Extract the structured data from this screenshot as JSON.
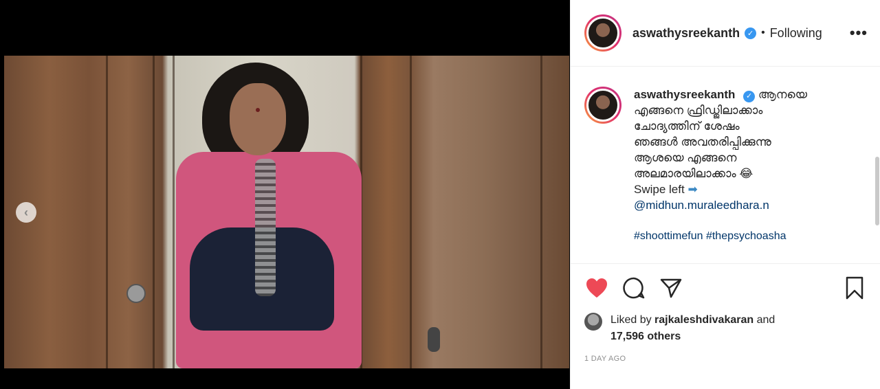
{
  "post": {
    "username": "aswathysreekanth",
    "follow_state": "Following",
    "more_label": "•••",
    "separator": "•"
  },
  "caption": {
    "username": "aswathysreekanth",
    "lines": [
      "ആനയെ",
      "എങ്ങനെ ഫ്രിഡ്ജിലാക്കാം",
      "ചോദ്യത്തിന് ശേഷം",
      "ഞങ്ങൾ അവതരിപ്പിക്കുന്നു",
      "ആശയെ എങ്ങനെ",
      "അലമാരയിലാക്കാം 😂"
    ],
    "swipe_text": "Swipe left",
    "swipe_emoji": "➡",
    "mention": "@midhun.muraleedhara.n",
    "hashtags": "#shoottimefun #thepsychoasha"
  },
  "likes": {
    "prefix": "Liked by ",
    "liker": "rajkaleshdivakaran",
    "conj": " and",
    "others": "17,596 others"
  },
  "timestamp": "1 DAY AGO",
  "icons": {
    "verified": "✓",
    "prev": "‹"
  },
  "colors": {
    "like_red": "#ed4956",
    "verified_blue": "#3897f0",
    "link_blue": "#003569"
  }
}
